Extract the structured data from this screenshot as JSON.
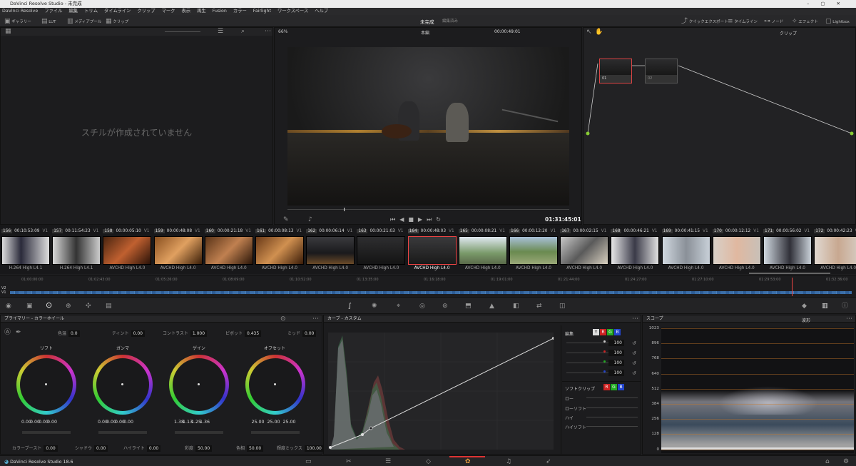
{
  "window": {
    "title": "DaVinci Resolve Studio - 未完成"
  },
  "menu": [
    "DaVinci Resolve",
    "ファイル",
    "編集",
    "トリム",
    "タイムライン",
    "クリップ",
    "マーク",
    "表示",
    "再生",
    "Fusion",
    "カラー",
    "Fairlight",
    "ワークスペース",
    "ヘルプ"
  ],
  "toolbar": {
    "gallery": "ギャラリー",
    "lut": "LUT",
    "media_pool": "メディアプール",
    "clips": "クリップ",
    "project_name": "未完成",
    "project_status": "編集済み",
    "quick_export": "クイックエクスポート",
    "timeline": "タイムライン",
    "nodes": "ノード",
    "effects": "エフェクト",
    "lightbox": "Lightbox"
  },
  "gallery": {
    "empty_text": "スチルが作成されていません"
  },
  "viewer": {
    "zoom": "66%",
    "mode": "本編",
    "timecode_top": "00:00:49:01",
    "timecode": "01:31:45:01"
  },
  "nodes": {
    "clip_menu": "クリップ",
    "node1": "01",
    "node2": "02"
  },
  "clips": [
    {
      "num": "156",
      "tc": "00:10:53:09",
      "tr": "V1",
      "codec": "H.264 High L4.1"
    },
    {
      "num": "157",
      "tc": "00:11:54:23",
      "tr": "V1",
      "codec": "H.264 High L4.1"
    },
    {
      "num": "158",
      "tc": "00:00:05:10",
      "tr": "V1",
      "codec": "AVCHD High L4.0"
    },
    {
      "num": "159",
      "tc": "00:00:48:08",
      "tr": "V1",
      "codec": "AVCHD High L4.0"
    },
    {
      "num": "160",
      "tc": "00:00:21:18",
      "tr": "V1",
      "codec": "AVCHD High L4.0"
    },
    {
      "num": "161",
      "tc": "00:00:08:13",
      "tr": "V1",
      "codec": "AVCHD High L4.0"
    },
    {
      "num": "162",
      "tc": "00:00:06:14",
      "tr": "V1",
      "codec": "AVCHD High L4.0"
    },
    {
      "num": "163",
      "tc": "00:00:21:03",
      "tr": "V1",
      "codec": "AVCHD High L4.0"
    },
    {
      "num": "164",
      "tc": "00:00:48:03",
      "tr": "V1",
      "codec": "AVCHD High L4.0"
    },
    {
      "num": "165",
      "tc": "00:00:08:21",
      "tr": "V1",
      "codec": "AVCHD High L4.0"
    },
    {
      "num": "166",
      "tc": "00:00:12:20",
      "tr": "V1",
      "codec": "AVCHD High L4.0"
    },
    {
      "num": "167",
      "tc": "00:00:02:15",
      "tr": "V1",
      "codec": "AVCHD High L4.0"
    },
    {
      "num": "168",
      "tc": "00:00:46:21",
      "tr": "V1",
      "codec": "AVCHD High L4.0"
    },
    {
      "num": "169",
      "tc": "00:00:41:15",
      "tr": "V1",
      "codec": "AVCHD High L4.0"
    },
    {
      "num": "170",
      "tc": "00:00:12:12",
      "tr": "V1",
      "codec": "AVCHD High L4.0"
    },
    {
      "num": "171",
      "tc": "00:00:56:02",
      "tr": "V1",
      "codec": "AVCHD High L4.0"
    },
    {
      "num": "172",
      "tc": "00:00:42:23",
      "tr": "V1",
      "codec": "AVCHD High L4.0"
    }
  ],
  "ruler": [
    "01:00:00:00",
    "01:02:43:00",
    "01:05:26:00",
    "01:08:09:00",
    "01:10:52:00",
    "01:13:35:00",
    "01:16:18:00",
    "01:19:01:00",
    "01:21:44:00",
    "01:24:27:00",
    "01:27:10:00",
    "01:29:53:00",
    "01:32:36:00"
  ],
  "tracks": [
    "V2",
    "V1"
  ],
  "primaries": {
    "title": "プライマリー - カラーホイール",
    "temp_label": "色温",
    "temp": "0.0",
    "tint_label": "ティント",
    "tint": "0.00",
    "contrast_label": "コントラスト",
    "contrast": "1.000",
    "pivot_label": "ピボット",
    "pivot": "0.435",
    "mid_label": "ミッド",
    "mid": "0.00",
    "wheels": [
      {
        "label": "リフト",
        "v": [
          "0.00",
          "0.00",
          "0.00",
          "0.00"
        ]
      },
      {
        "label": "ガンマ",
        "v": [
          "0.00",
          "0.00",
          "0.00",
          "0.00"
        ]
      },
      {
        "label": "ゲイン",
        "v": [
          "1.38",
          "1.13",
          "1.25",
          "1.36"
        ]
      },
      {
        "label": "オフセット",
        "v": [
          "25.00",
          "25.00",
          "25.00"
        ]
      }
    ],
    "boost_label": "カラーブースト",
    "boost": "0.00",
    "shadow_label": "シャドウ",
    "shadow": "0.00",
    "hilite_label": "ハイライト",
    "hilite": "0.00",
    "sat_label": "彩度",
    "sat": "50.00",
    "hue_label": "色相",
    "hue": "50.00",
    "lummix_label": "輝度ミックス",
    "lummix": "100.00"
  },
  "curves": {
    "title": "カーブ - カスタム",
    "edit_label": "編集",
    "ch": [
      "Y",
      "R",
      "G",
      "B"
    ],
    "values": [
      "100",
      "100",
      "100",
      "100"
    ],
    "soft_clip": "ソフトクリップ",
    "low": "ロー",
    "low_soft": "ローソフト",
    "high": "ハイ",
    "high_soft": "ハイソフト"
  },
  "scope": {
    "title": "スコープ",
    "mode": "波形",
    "y": [
      "1023",
      "896",
      "768",
      "640",
      "512",
      "384",
      "256",
      "128",
      "0"
    ]
  },
  "footer": {
    "app": "DaVinci Resolve Studio 18.6"
  }
}
